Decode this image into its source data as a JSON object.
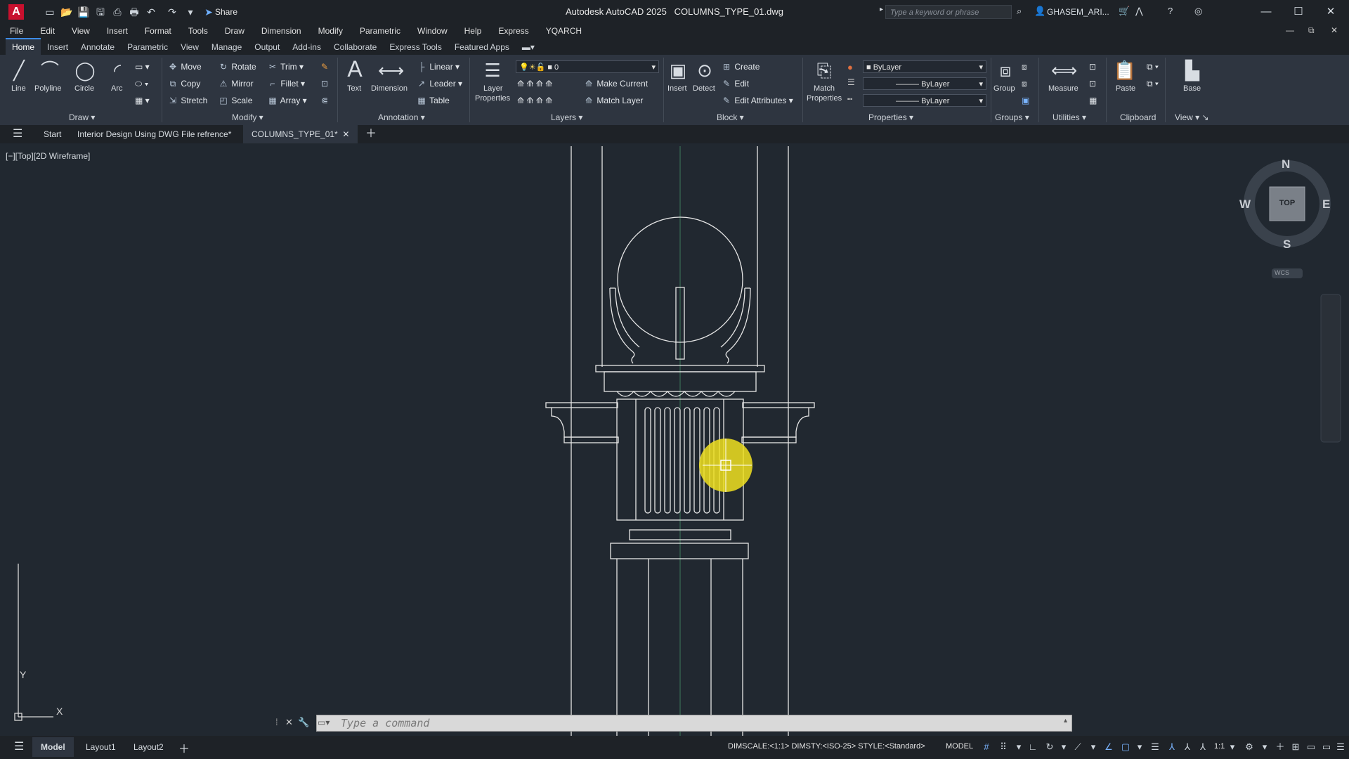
{
  "app": {
    "title": "Autodesk AutoCAD 2025",
    "filename": "COLUMNS_TYPE_01.dwg",
    "logo_letter": "A",
    "share_label": "Share",
    "search_placeholder": "Type a keyword or phrase",
    "user": "GHASEM_ARI..."
  },
  "menu": [
    "File",
    "Edit",
    "View",
    "Insert",
    "Format",
    "Tools",
    "Draw",
    "Dimension",
    "Modify",
    "Parametric",
    "Window",
    "Help",
    "Express",
    "YQARCH"
  ],
  "ribbon_tabs": [
    "Home",
    "Insert",
    "Annotate",
    "Parametric",
    "View",
    "Manage",
    "Output",
    "Add-ins",
    "Collaborate",
    "Express Tools",
    "Featured Apps"
  ],
  "active_ribbon_tab": "Home",
  "panels": {
    "draw": {
      "title": "Draw",
      "line": "Line",
      "polyline": "Polyline",
      "circle": "Circle",
      "arc": "Arc"
    },
    "modify": {
      "title": "Modify",
      "move": "Move",
      "rotate": "Rotate",
      "trim": "Trim",
      "copy": "Copy",
      "mirror": "Mirror",
      "fillet": "Fillet",
      "stretch": "Stretch",
      "scale": "Scale",
      "array": "Array"
    },
    "annotation": {
      "title": "Annotation",
      "text": "Text",
      "dimension": "Dimension",
      "linear": "Linear",
      "leader": "Leader",
      "table": "Table"
    },
    "layers": {
      "title": "Layers",
      "layer_properties_1": "Layer",
      "layer_properties_2": "Properties",
      "current_layer": "0",
      "make_current": "Make Current",
      "match_layer": "Match Layer"
    },
    "block": {
      "title": "Block",
      "insert": "Insert",
      "detect": "Detect",
      "create": "Create",
      "edit": "Edit",
      "edit_attributes": "Edit Attributes"
    },
    "properties": {
      "title": "Properties",
      "match_1": "Match",
      "match_2": "Properties",
      "color": "ByLayer",
      "linetype": "ByLayer",
      "lineweight": "ByLayer"
    },
    "groups": {
      "title": "Groups",
      "group": "Group"
    },
    "utilities": {
      "title": "Utilities",
      "measure": "Measure"
    },
    "clipboard": {
      "title": "Clipboard",
      "paste": "Paste"
    },
    "view": {
      "title": "View",
      "base": "Base"
    }
  },
  "doc_tabs": {
    "start": "Start",
    "tab1": "Interior Design Using DWG File refrence*",
    "tab2": "COLUMNS_TYPE_01*"
  },
  "viewport_label": "[−][Top][2D Wireframe]",
  "viewcube": {
    "n": "N",
    "s": "S",
    "e": "E",
    "w": "W",
    "face": "TOP",
    "wcs": "WCS"
  },
  "ucs": {
    "x": "X",
    "y": "Y"
  },
  "command_placeholder": "Type a command",
  "layout_tabs": {
    "model": "Model",
    "layout1": "Layout1",
    "layout2": "Layout2"
  },
  "status": {
    "dim": "DIMSCALE:<1:1> DIMSTY:<ISO-25> STYLE:<Standard>",
    "space": "MODEL",
    "scale": "1:1"
  },
  "colors": {
    "accent": "#3c8ce7",
    "background": "#212830",
    "ribbon": "#2e3540",
    "cursor_highlight": "#f0e020"
  }
}
